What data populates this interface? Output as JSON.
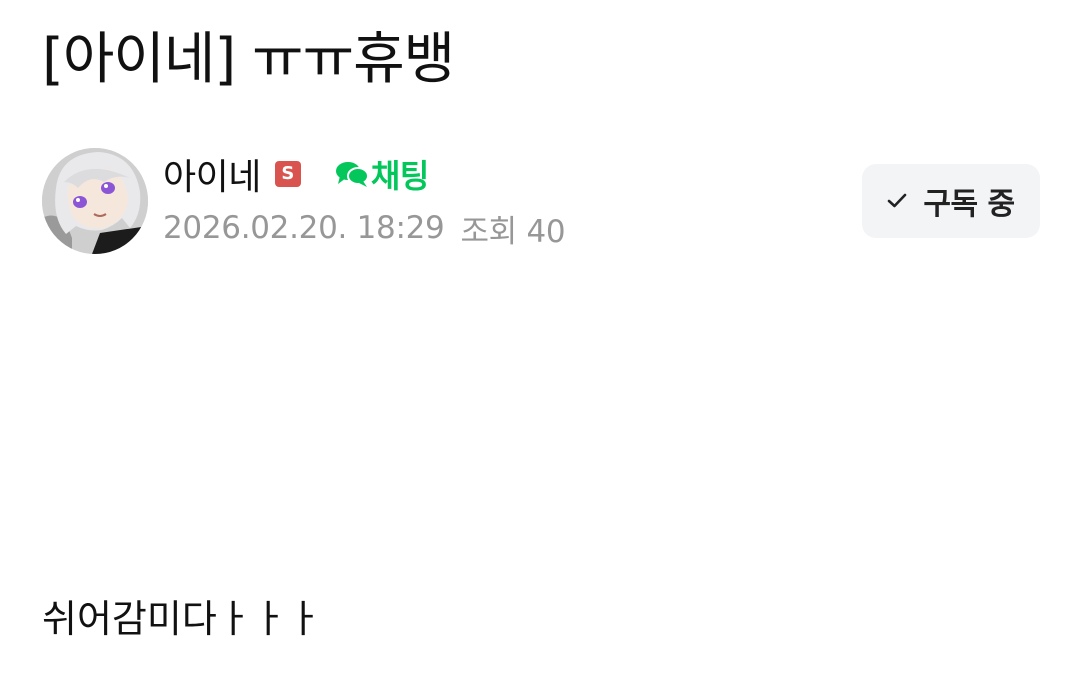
{
  "post": {
    "title": "[아이네] ㅠㅠ휴뱅",
    "body": "쉬어감미다ㅏㅏㅏ"
  },
  "author": {
    "name": "아이네",
    "grade_badge": "S",
    "chat_label": "채팅",
    "avatar_icon": "anime-girl-avatar"
  },
  "meta": {
    "datetime": "2026.02.20. 18:29",
    "views": "조회 40"
  },
  "subscribe": {
    "label": "구독 중",
    "icon": "check-icon"
  },
  "colors": {
    "chat_green": "#03c75a",
    "badge_red": "#d9534f",
    "meta_gray": "#979797",
    "button_bg": "#f3f4f6"
  }
}
